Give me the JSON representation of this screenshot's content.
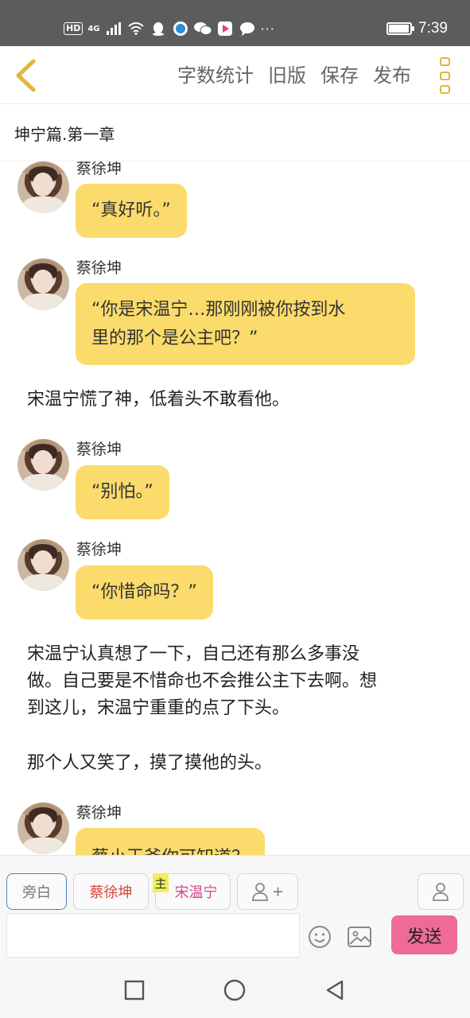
{
  "status_bar": {
    "network": "HD",
    "signal": "4G",
    "more": "···",
    "battery_level": 0.9,
    "time": "7:39"
  },
  "toolbar": {
    "back_icon": "back-chevron-icon",
    "word_count": "字数统计",
    "old_version": "旧版",
    "save": "保存",
    "publish": "发布",
    "menu_icon": "more-menu-icon",
    "accent": "#e1b63d"
  },
  "chapter_title": "坤宁篇.第一章",
  "messages": [
    {
      "type": "dialog",
      "speaker": "蔡徐坤",
      "text": "“真好听。”"
    },
    {
      "type": "dialog",
      "speaker": "蔡徐坤",
      "text": "“你是宋温宁…那刚刚被你按到水",
      "text2": "里的那个是公主吧？”"
    },
    {
      "type": "narration",
      "text": "宋温宁慌了神，低着头不敢看他。"
    },
    {
      "type": "dialog",
      "speaker": "蔡徐坤",
      "text": "“别怕。”"
    },
    {
      "type": "dialog",
      "speaker": "蔡徐坤",
      "text": "“你惜命吗？”"
    },
    {
      "type": "narration",
      "lines": [
        "宋温宁认真想了一下，自己还有那么多事没",
        "做。自己要是不惜命也不会推公主下去啊。想",
        "到这儿，宋温宁重重的点了下头。"
      ]
    },
    {
      "type": "narration",
      "text": "那个人又笑了，摸了摸他的头。"
    },
    {
      "type": "dialog",
      "speaker": "蔡徐坤",
      "text": "蔡小王爷你可知道？"
    }
  ],
  "roles": {
    "narrator": "旁白",
    "cai": "蔡徐坤",
    "main_tag": "主",
    "song": "宋温宁",
    "add_label": "+"
  },
  "input": {
    "value": "",
    "placeholder": ""
  },
  "send_label": "发送",
  "colors": {
    "bubble": "#fbdb6b",
    "send": "#f06a97",
    "status_bar": "#5c5c5c"
  }
}
